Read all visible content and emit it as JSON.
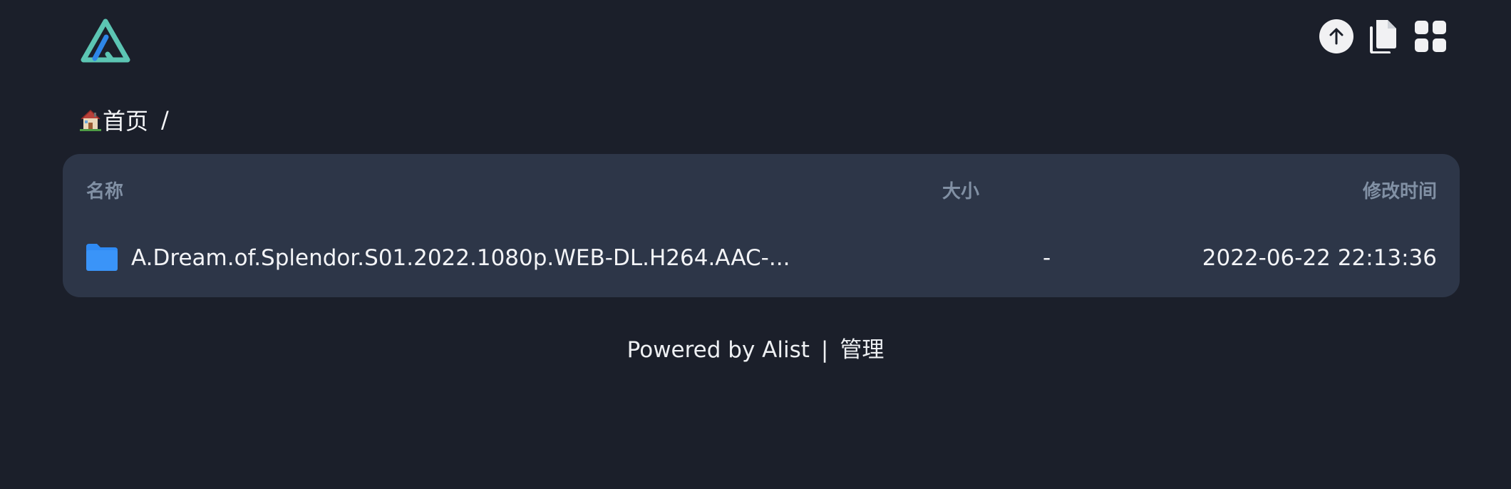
{
  "header": {
    "logo_icon": "alist-logo",
    "actions": [
      {
        "icon": "arrow-up-circle-icon",
        "label": "back to top"
      },
      {
        "icon": "copy-files-icon",
        "label": "copy"
      },
      {
        "icon": "grid-view-icon",
        "label": "grid view"
      }
    ]
  },
  "breadcrumb": {
    "home_emoji": "🏠",
    "home_label": "首页",
    "separator": "/"
  },
  "table": {
    "headers": {
      "name": "名称",
      "size": "大小",
      "modified": "修改时间"
    },
    "rows": [
      {
        "icon": "folder-icon",
        "name": "A.Dream.of.Splendor.S01.2022.1080p.WEB-DL.H264.AAC-...",
        "size": "-",
        "modified": "2022-06-22 22:13:36"
      }
    ]
  },
  "footer": {
    "powered_by": "Powered by Alist",
    "separator": "|",
    "admin_link": "管理"
  },
  "colors": {
    "background": "#1b1f2a",
    "card": "#2d3648",
    "header_text": "#8190a4",
    "folder": "#2f8bf5",
    "logo_teal": "#5cc5b3",
    "logo_blue": "#2e86e8"
  }
}
